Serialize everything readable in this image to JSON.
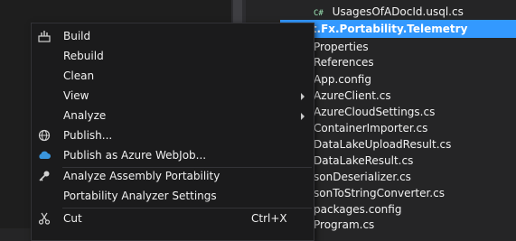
{
  "tree": {
    "rows": [
      {
        "label": "UsagesOfADocId.usql.cs",
        "badge": "C#"
      },
      {
        "label": "rosoft.Fx.Portability.Telemetry"
      },
      {
        "label": "Properties"
      },
      {
        "label": "References"
      },
      {
        "label": "App.config"
      },
      {
        "label": "AzureClient.cs"
      },
      {
        "label": "AzureCloudSettings.cs"
      },
      {
        "label": "ContainerImporter.cs"
      },
      {
        "label": "DataLakeUploadResult.cs"
      },
      {
        "label": "DataLakeResult.cs"
      },
      {
        "label": "sonDeserializer.cs"
      },
      {
        "label": "sonToStringConverter.cs"
      },
      {
        "label": "packages.config"
      },
      {
        "label": "Program.cs"
      }
    ]
  },
  "menu": {
    "items": [
      {
        "label": "Build",
        "icon": "build-icon"
      },
      {
        "label": "Rebuild"
      },
      {
        "label": "Clean"
      },
      {
        "label": "View",
        "submenu": true
      },
      {
        "label": "Analyze",
        "submenu": true
      },
      {
        "label": "Publish...",
        "icon": "globe-icon"
      },
      {
        "label": "Publish as Azure WebJob...",
        "icon": "cloud-icon"
      },
      {
        "label": "Analyze Assembly Portability",
        "icon": "key-icon"
      },
      {
        "label": "Portability Analyzer Settings"
      },
      {
        "label": "Cut",
        "shortcut": "Ctrl+X",
        "icon": "scissors-icon"
      }
    ]
  },
  "colors": {
    "selection": "#3399ff",
    "menu_bg": "#1b1b1c",
    "panel_bg": "#252526"
  }
}
